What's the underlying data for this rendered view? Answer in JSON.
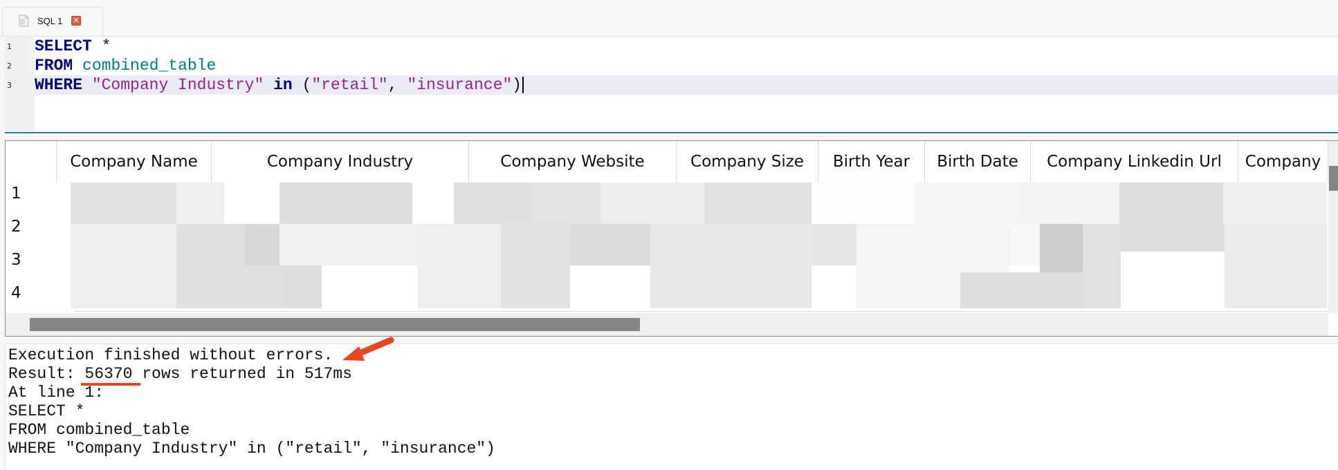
{
  "tabs": [
    {
      "label": "SQL 1",
      "icon": "document-icon",
      "close_icon": "close-icon",
      "close_glyph": "×"
    }
  ],
  "editor": {
    "line_numbers": [
      "1",
      "2",
      "3"
    ],
    "lines": [
      {
        "tokens": [
          {
            "t": "SELECT",
            "c": "kw"
          },
          {
            "t": " *",
            "c": "plain"
          }
        ]
      },
      {
        "tokens": [
          {
            "t": "FROM",
            "c": "kw"
          },
          {
            "t": " ",
            "c": "plain"
          },
          {
            "t": "combined_table",
            "c": "tbl"
          }
        ]
      },
      {
        "tokens": [
          {
            "t": "WHERE",
            "c": "kw"
          },
          {
            "t": " ",
            "c": "plain"
          },
          {
            "t": "\"Company Industry\"",
            "c": "str"
          },
          {
            "t": " ",
            "c": "plain"
          },
          {
            "t": "in",
            "c": "kw"
          },
          {
            "t": " (",
            "c": "plain"
          },
          {
            "t": "\"retail\"",
            "c": "str"
          },
          {
            "t": ", ",
            "c": "plain"
          },
          {
            "t": "\"insurance\"",
            "c": "str"
          },
          {
            "t": ")",
            "c": "plain"
          }
        ],
        "current": true
      }
    ],
    "colors": {
      "keyword": "#00007f",
      "table": "#007f7f",
      "string": "#93278f",
      "accent_border": "#2a7ab0"
    }
  },
  "results": {
    "columns": [
      "Company Name",
      "Company Industry",
      "Company Website",
      "Company Size",
      "Birth Year",
      "Birth Date",
      "Company Linkedin Url",
      "Company"
    ],
    "row_numbers": [
      "1",
      "2",
      "3",
      "4"
    ],
    "cells_redacted": true
  },
  "log": {
    "lines": [
      "Execution finished without errors.",
      "Result: 56370 rows returned in 517ms",
      "At line 1:",
      "SELECT *",
      "FROM combined_table",
      "WHERE \"Company Industry\" in (\"retail\", \"insurance\")"
    ],
    "annotation_color": "#e8461f"
  }
}
